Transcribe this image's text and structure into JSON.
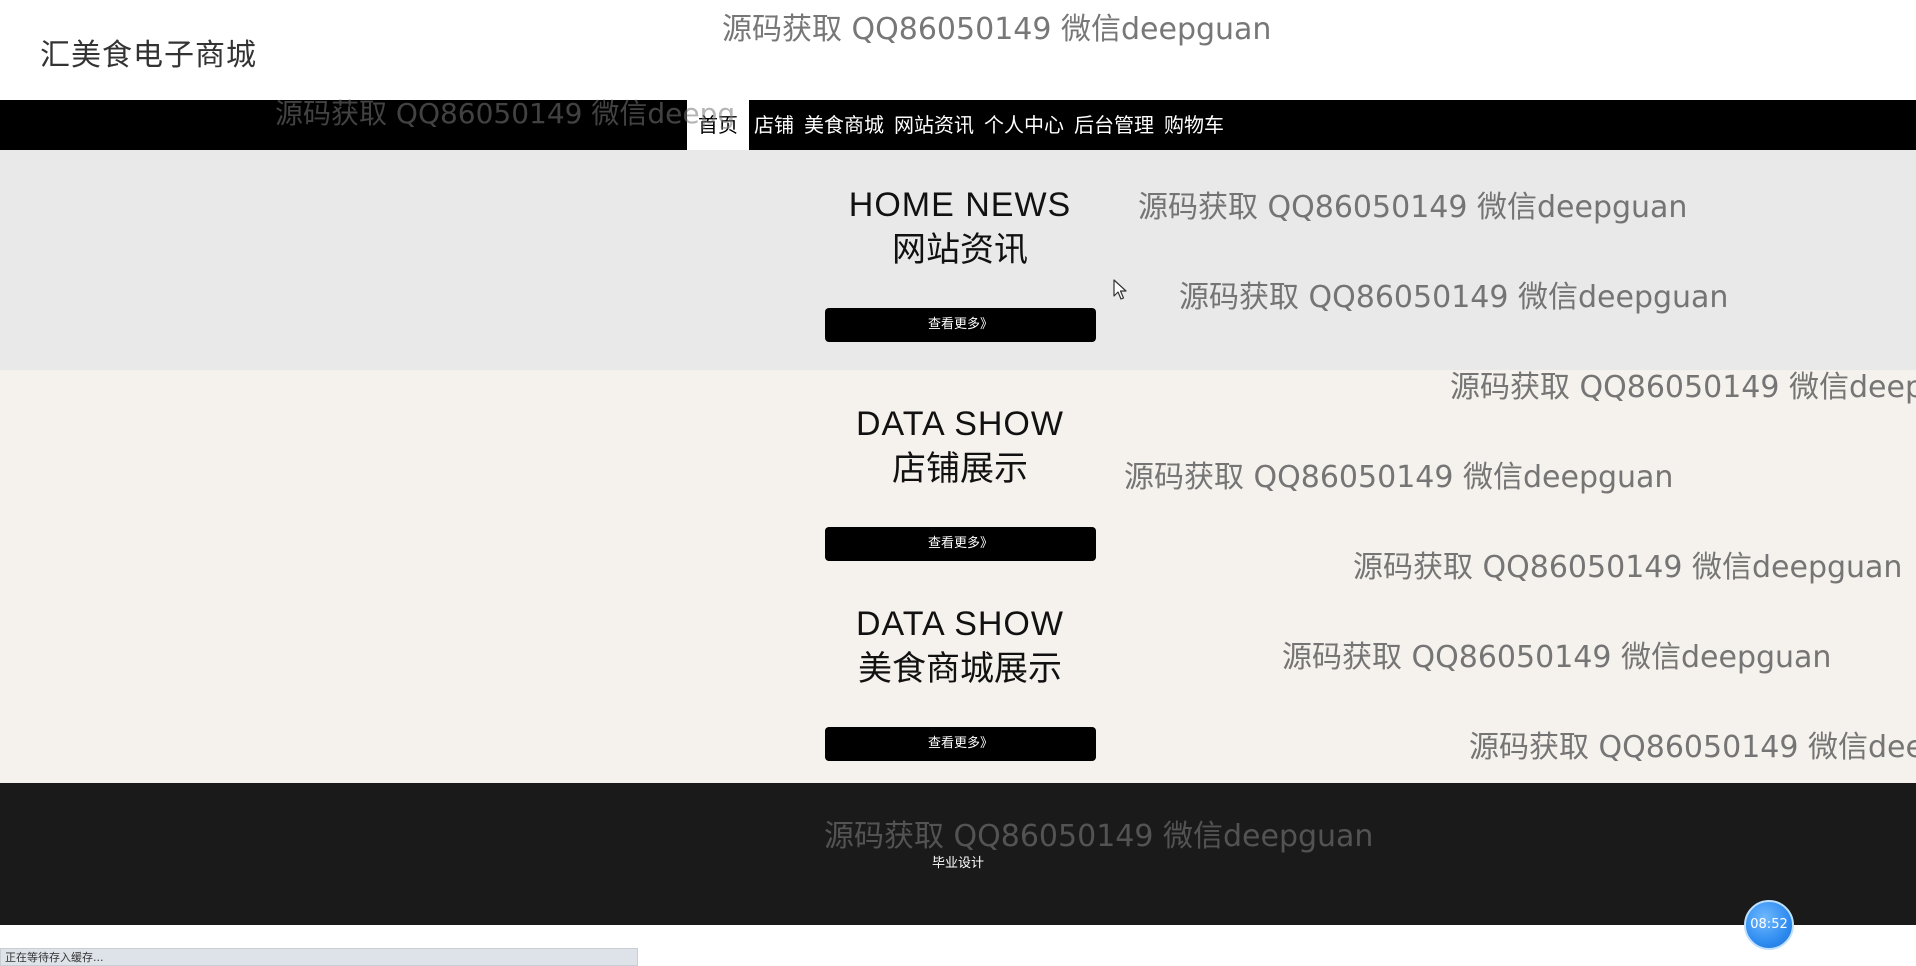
{
  "site": {
    "title": "汇美食电子商城"
  },
  "nav": {
    "items": [
      {
        "label": "首页",
        "active": true
      },
      {
        "label": "店铺",
        "active": false
      },
      {
        "label": "美食商城",
        "active": false
      },
      {
        "label": "网站资讯",
        "active": false
      },
      {
        "label": "个人中心",
        "active": false
      },
      {
        "label": "后台管理",
        "active": false
      },
      {
        "label": "购物车",
        "active": false
      }
    ]
  },
  "sections": {
    "news": {
      "title_en": "HOME NEWS",
      "title_cn": "网站资讯",
      "more": "查看更多》"
    },
    "shops": {
      "title_en": "DATA SHOW",
      "title_cn": "店铺展示",
      "more": "查看更多》"
    },
    "foods": {
      "title_en": "DATA SHOW",
      "title_cn": "美食商城展示",
      "more": "查看更多》"
    }
  },
  "footer": {
    "text": "毕业设计"
  },
  "watermark": {
    "text": "源码获取 QQ86050149 微信deepguan",
    "partial_right": "源码获取 QQ86050149 微信deepg",
    "partial_right2": "源码获取 QQ86050149 微信deep"
  },
  "status": {
    "text": "正在等待存入缓存..."
  },
  "clock": {
    "time": "08:52"
  },
  "colors": {
    "nav_bg": "#000000",
    "news_bg": "#e9e9e9",
    "data_bg": "#f5f1ed",
    "footer_bg": "#1a1a1a",
    "badge": "#2f8cf0"
  }
}
